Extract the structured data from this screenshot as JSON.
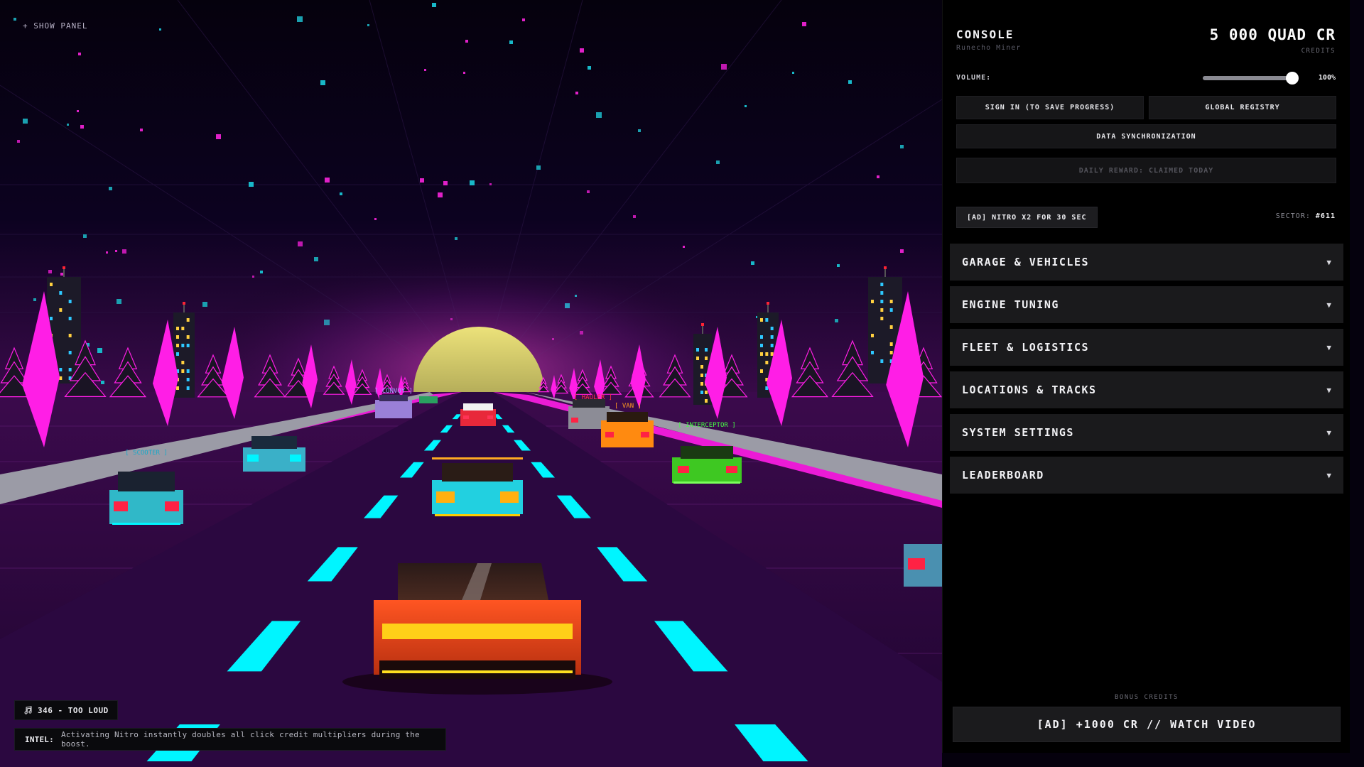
{
  "overlay": {
    "show_panel": "+ SHOW PANEL",
    "track_badge": "346 - TOO LOUD",
    "intel_label": "INTEL:",
    "intel_text": "Activating Nitro instantly doubles all click credit multipliers during the boost."
  },
  "vehicle_tags": {
    "convoy": "[ CONVOY ]",
    "hauler": "[ HAULER ]",
    "van": "[ VAN ]",
    "interceptor": "[ INTERCEPTOR ]",
    "scooter": "[ SCOOTER ]"
  },
  "console": {
    "title": "CONSOLE",
    "subtitle": "Runecho Miner",
    "credits_value": "5 000 QUAD CR",
    "credits_label": "CREDITS",
    "volume_label": "VOLUME:",
    "volume_level": 100,
    "volume_text": "100%",
    "sign_in": "SIGN IN (TO SAVE PROGRESS)",
    "global_registry": "GLOBAL REGISTRY",
    "data_sync": "DATA SYNCHRONIZATION",
    "daily_reward": "DAILY REWARD: CLAIMED TODAY",
    "ad_nitro": "[AD] NITRO X2 FOR 30 SEC",
    "sector_label": "SECTOR:",
    "sector_value": "#611",
    "sections": [
      {
        "label": "GARAGE & VEHICLES",
        "arrow": "▼"
      },
      {
        "label": "ENGINE TUNING",
        "arrow": "▼"
      },
      {
        "label": "FLEET & LOGISTICS",
        "arrow": "▼"
      },
      {
        "label": "LOCATIONS & TRACKS",
        "arrow": "▼"
      },
      {
        "label": "SYSTEM SETTINGS",
        "arrow": "▼"
      },
      {
        "label": "LEADERBOARD",
        "arrow": "▼"
      }
    ],
    "bonus_label": "BONUS CREDITS",
    "watch_video": "[AD] +1000 CR // WATCH VIDEO"
  },
  "colors": {
    "neon_magenta": "#ff1ee6",
    "neon_cyan": "#00f5ff",
    "sun": "#f0e67a",
    "panel_bg": "#000000",
    "button_bg": "#1a1a1c"
  }
}
